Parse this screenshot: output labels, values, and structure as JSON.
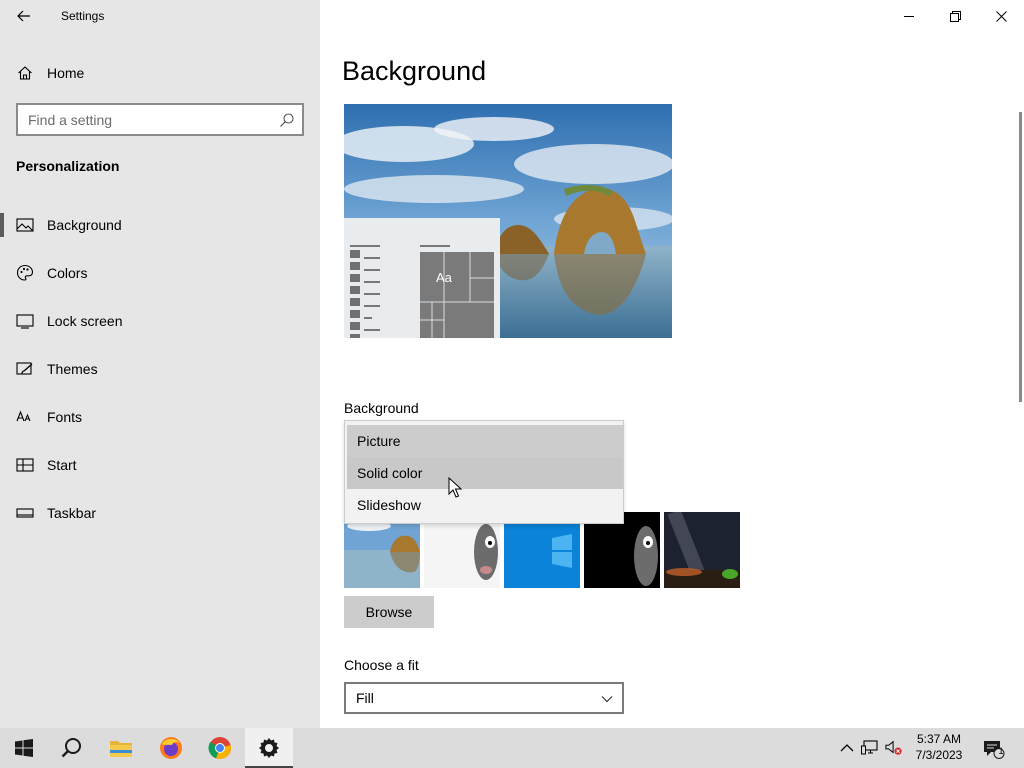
{
  "window": {
    "title": "Settings",
    "minimize_icon": "minimize-icon",
    "restore_icon": "restore-icon",
    "close_icon": "close-icon"
  },
  "sidebar": {
    "home": {
      "label": "Home",
      "icon": "home-icon"
    },
    "search": {
      "placeholder": "Find a setting",
      "value": ""
    },
    "section_title": "Personalization",
    "items": [
      {
        "label": "Background",
        "icon": "picture-icon",
        "selected": true
      },
      {
        "label": "Colors",
        "icon": "palette-icon",
        "selected": false
      },
      {
        "label": "Lock screen",
        "icon": "lock-screen-icon",
        "selected": false
      },
      {
        "label": "Themes",
        "icon": "brush-icon",
        "selected": false
      },
      {
        "label": "Fonts",
        "icon": "font-icon",
        "selected": false
      },
      {
        "label": "Start",
        "icon": "start-layout-icon",
        "selected": false
      },
      {
        "label": "Taskbar",
        "icon": "taskbar-icon",
        "selected": false
      }
    ]
  },
  "main": {
    "page_title": "Background",
    "preview": {
      "sample_text": "Aa"
    },
    "background_label": "Background",
    "background_options": [
      "Picture",
      "Solid color",
      "Slideshow"
    ],
    "background_selected": "Picture",
    "background_hovered": "Solid color",
    "browse_label": "Browse",
    "fit_label": "Choose a fit",
    "fit_value": "Fill"
  },
  "taskbar": {
    "apps": [
      {
        "name": "start",
        "icon": "windows-logo-icon"
      },
      {
        "name": "search",
        "icon": "search-icon"
      },
      {
        "name": "file-explorer",
        "icon": "folder-icon"
      },
      {
        "name": "firefox",
        "icon": "firefox-icon"
      },
      {
        "name": "chrome",
        "icon": "chrome-icon"
      },
      {
        "name": "settings",
        "icon": "gear-icon",
        "active": true
      }
    ],
    "tray": [
      "chevron-up-icon",
      "network-icon",
      "volume-muted-icon"
    ],
    "time": "5:37 AM",
    "date": "7/3/2023",
    "notification_count": "1"
  },
  "colors": {
    "sidebar_bg": "#e6e6e6",
    "taskbar_bg": "#dcdcdc",
    "accent": "#0078d7"
  }
}
